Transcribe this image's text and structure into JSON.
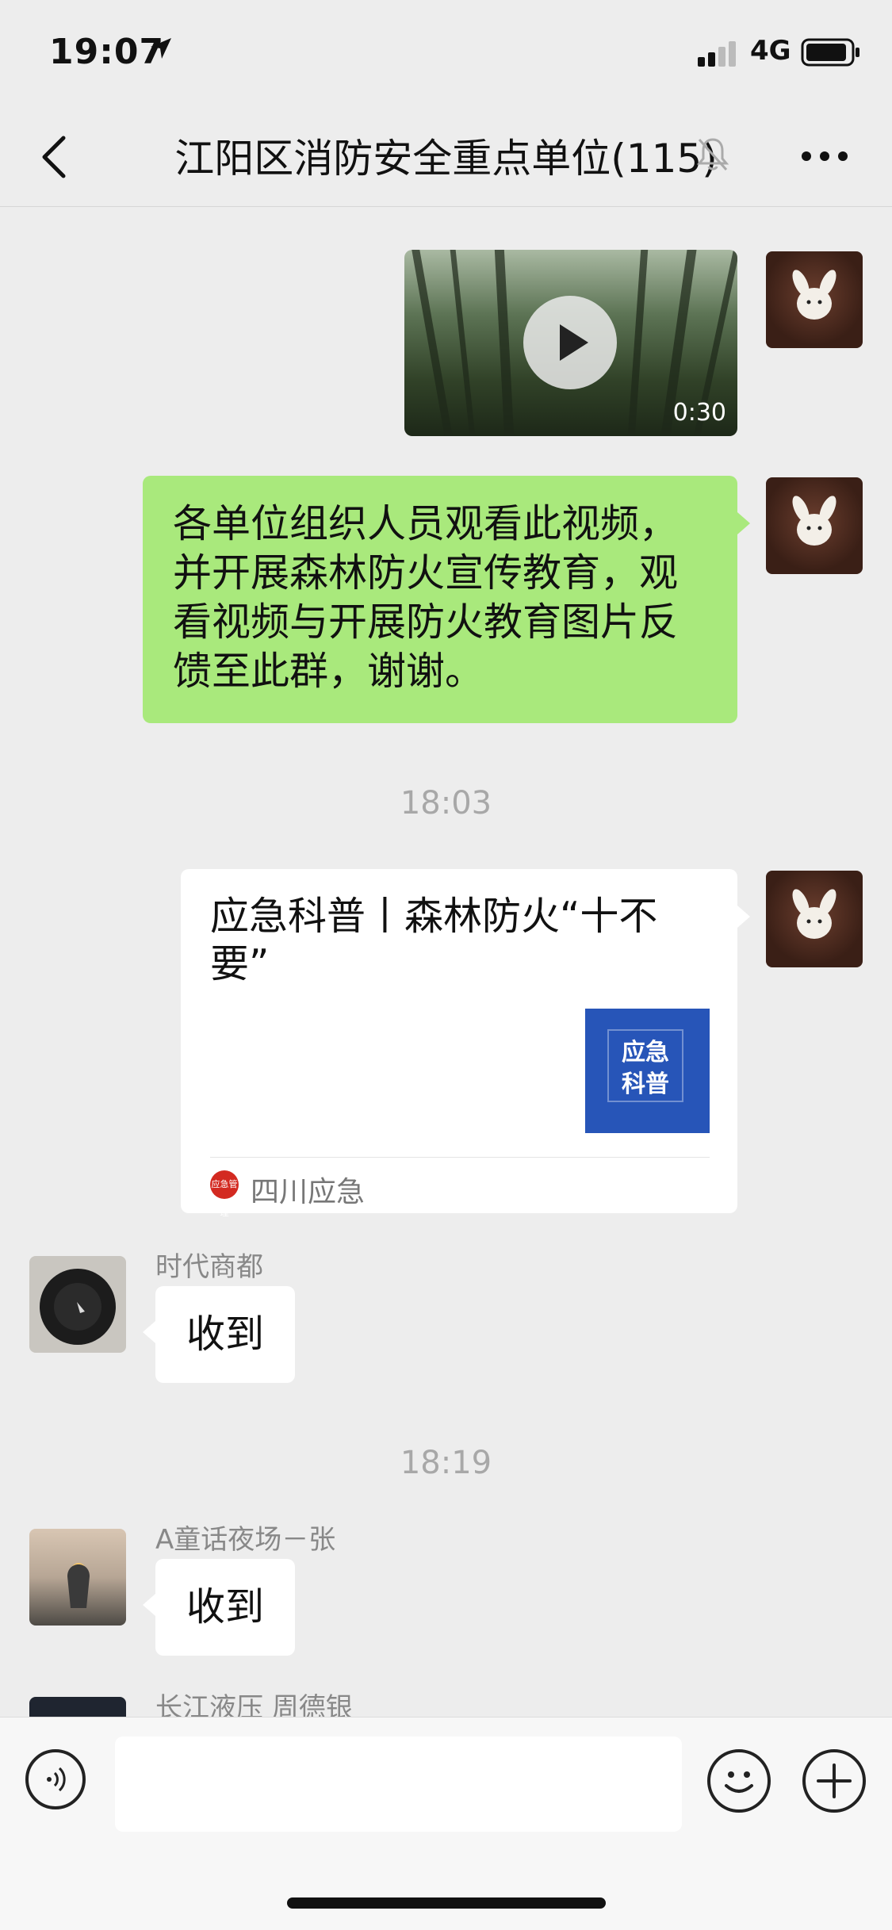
{
  "status_bar": {
    "time": "19:07",
    "network": "4G"
  },
  "header": {
    "title": "江阳区消防安全重点单位(115)"
  },
  "messages": {
    "video": {
      "duration": "0:30"
    },
    "text": {
      "content": "各单位组织人员观看此视频，并开展森林防火宣传教育，观看视频与开展防火教育图片反馈至此群，谢谢。"
    },
    "time1": "18:03",
    "article": {
      "title": "应急科普丨森林防火“十不要”",
      "thumb_line1": "应急",
      "thumb_line2": "科普",
      "source": "四川应急",
      "source_icon_text": "应急管理"
    },
    "incoming1": {
      "sender": "时代商都",
      "text": "收到"
    },
    "time2": "18:19",
    "incoming2": {
      "sender": "A童话夜场－张",
      "text": "收到"
    },
    "incoming3": {
      "sender": "长江液压 周德银"
    }
  },
  "colors": {
    "green_bubble": "#a9e97c",
    "background": "#ededed",
    "article_thumb": "#2755b8"
  }
}
